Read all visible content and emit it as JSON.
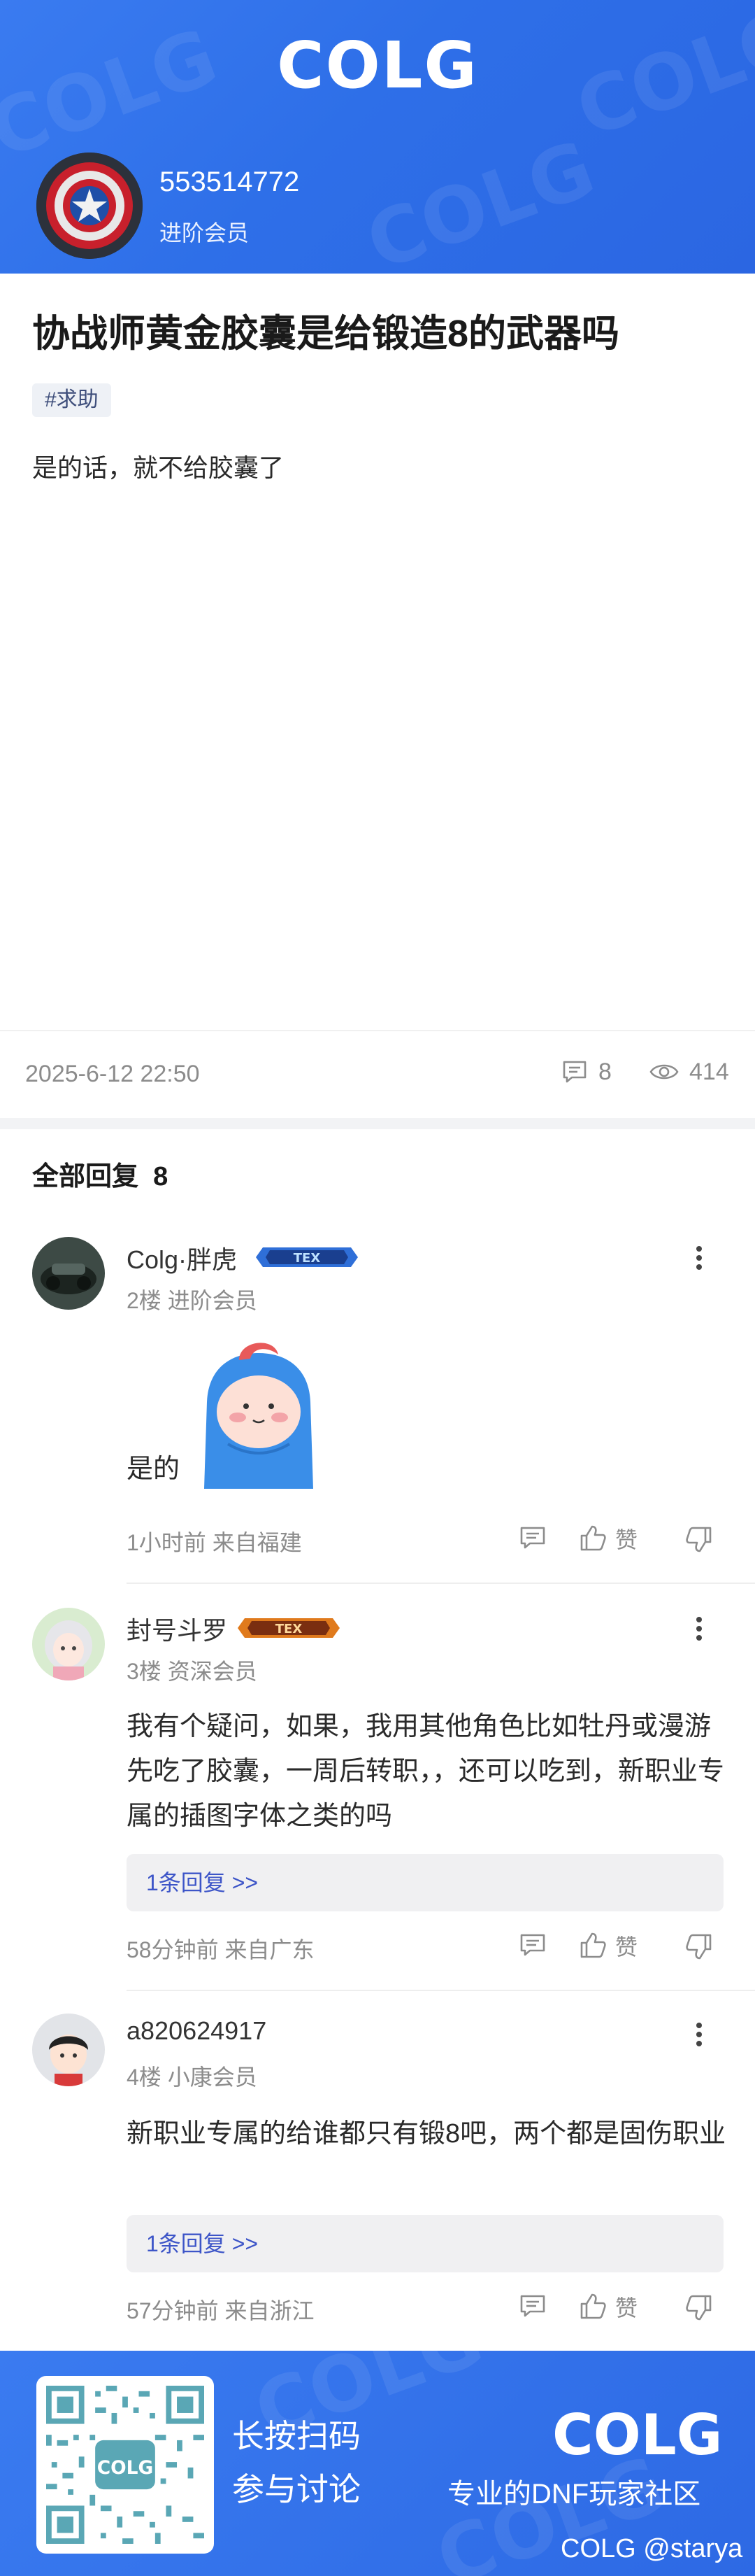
{
  "header": {
    "logo": "COLG",
    "username": "553514772",
    "level": "进阶会员"
  },
  "post": {
    "title": "协战师黄金胶囊是给锻造8的武器吗",
    "tag": "#求助",
    "body": "是的话，就不给胶囊了",
    "date": "2025-6-12 22:50",
    "comment_count": "8",
    "view_count": "414"
  },
  "replies_header": {
    "label": "全部回复",
    "count": "8"
  },
  "comments": [
    {
      "name": "Colg·胖虎",
      "badge": "TEX",
      "floor": "2楼",
      "level": "进阶会员",
      "body": "是的",
      "time": "1小时前",
      "location": "来自福建",
      "like_label": "赞"
    },
    {
      "name": "封号斗罗",
      "badge": "TEX",
      "floor": "3楼",
      "level": "资深会员",
      "body": "我有个疑问，如果，我用其他角色比如牡丹或漫游先吃了胶囊，一周后转职，，还可以吃到，新职业专属的插图字体之类的吗",
      "reply_link": "1条回复 >>",
      "time": "58分钟前",
      "location": "来自广东",
      "like_label": "赞"
    },
    {
      "name": "a820624917",
      "floor": "4楼",
      "level": "小康会员",
      "body": "新职业专属的给谁都只有锻8吧，两个都是固伤职业",
      "reply_link": "1条回复 >>",
      "time": "57分钟前",
      "location": "来自浙江",
      "like_label": "赞"
    }
  ],
  "footer": {
    "line1": "长按扫码",
    "line2": "参与讨论",
    "logo": "COLG",
    "slogan": "专业的DNF玩家社区",
    "credit": "COLG @starya"
  },
  "colors": {
    "brand_blue": "#2e6fe8",
    "link_blue": "#3d55c8",
    "meta_gray": "#8c8c8c"
  }
}
